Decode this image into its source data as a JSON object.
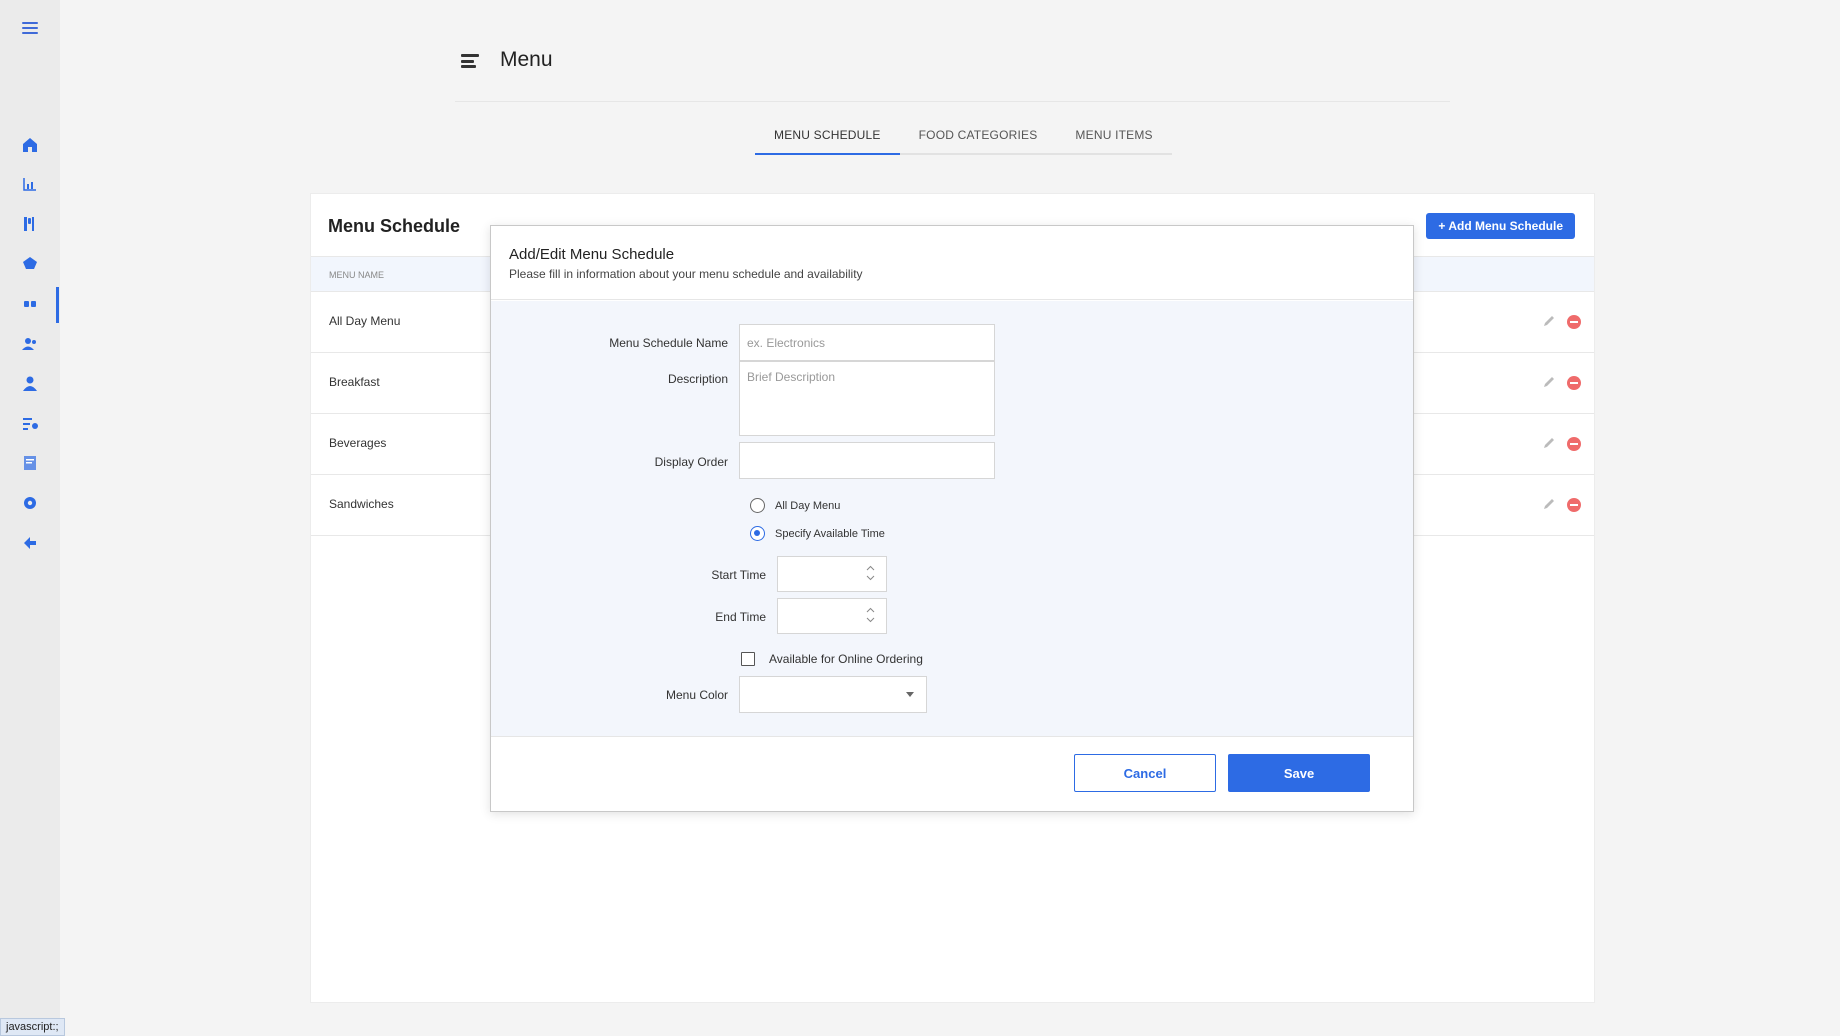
{
  "sidebar": {
    "icons": [
      {
        "name": "home-icon",
        "color": "#2d6be4"
      },
      {
        "name": "chart-icon",
        "color": "#2d6be4"
      },
      {
        "name": "utensils-icon",
        "color": "#2d6be4"
      },
      {
        "name": "pie-icon",
        "color": "#2d6be4"
      },
      {
        "name": "menu-cards-icon",
        "color": "#2d6be4"
      },
      {
        "name": "users-icon",
        "color": "#2d6be4"
      },
      {
        "name": "user-icon",
        "color": "#2d6be4"
      },
      {
        "name": "list-user-icon",
        "color": "#2d6be4"
      },
      {
        "name": "report-icon",
        "color": "#2d6be4"
      },
      {
        "name": "gear-icon",
        "color": "#2d6be4"
      },
      {
        "name": "back-arrow-icon",
        "color": "#2d6be4"
      }
    ],
    "active_index": 4
  },
  "header": {
    "title": "Menu"
  },
  "tabs": [
    {
      "label": "MENU SCHEDULE",
      "active": true
    },
    {
      "label": "FOOD CATEGORIES",
      "active": false
    },
    {
      "label": "MENU ITEMS",
      "active": false
    }
  ],
  "card": {
    "title": "Menu Schedule",
    "add_button": "+ Add Menu Schedule",
    "column_header": "MENU NAME",
    "rows": [
      {
        "name": "All Day Menu"
      },
      {
        "name": "Breakfast"
      },
      {
        "name": "Beverages"
      },
      {
        "name": "Sandwiches"
      }
    ]
  },
  "modal": {
    "title": "Add/Edit Menu Schedule",
    "subtitle": "Please fill in information about your menu schedule and availability",
    "fields": {
      "name_label": "Menu Schedule Name",
      "name_placeholder": "ex. Electronics",
      "name_value": "",
      "description_label": "Description",
      "description_placeholder": "Brief Description",
      "display_order_label": "Display Order",
      "display_order_value": "",
      "start_time_label": "Start Time",
      "end_time_label": "End Time",
      "menu_color_label": "Menu Color"
    },
    "availability": {
      "options": [
        {
          "label": "All Day Menu",
          "checked": false
        },
        {
          "label": "Specify Available Time",
          "checked": true
        }
      ]
    },
    "online_ordering": {
      "label": "Available for Online Ordering",
      "checked": false
    },
    "cancel_label": "Cancel",
    "save_label": "Save"
  },
  "colors": {
    "accent": "#2d6be4",
    "danger": "#ef6b6b",
    "modal_body_bg": "#f3f6fc"
  },
  "status_bar": {
    "text": "javascript:;"
  }
}
